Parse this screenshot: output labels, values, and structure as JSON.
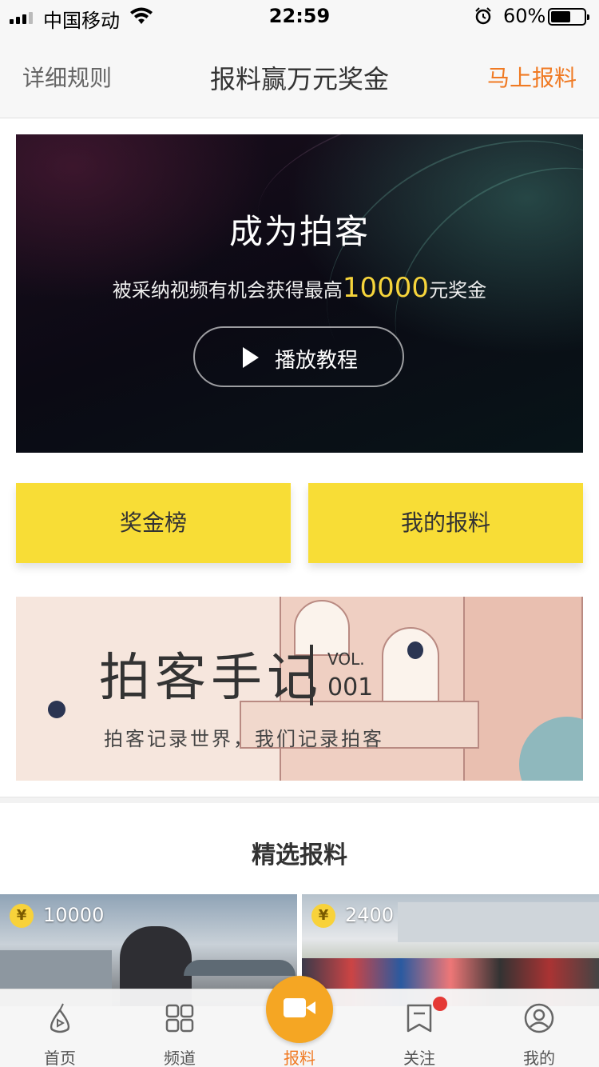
{
  "status_bar": {
    "carrier": "中国移动",
    "time": "22:59",
    "battery": "60%",
    "battery_level": 0.6
  },
  "nav": {
    "left": "详细规则",
    "title": "报料赢万元奖金",
    "right": "马上报料",
    "right_color": "#f07a23"
  },
  "hero": {
    "title": "成为拍客",
    "subtitle_prefix": "被采纳视频有机会获得最高",
    "subtitle_amount": "10000",
    "subtitle_suffix": "元奖金",
    "play_label": "播放教程"
  },
  "buttons": {
    "rank": "奖金榜",
    "mine": "我的报料",
    "color": "#f8dd36"
  },
  "promo": {
    "title": "拍客手记",
    "vol": "VOL.",
    "num": "001",
    "slogan": "拍客记录世界，我们记录拍客"
  },
  "section": {
    "title": "精选报料"
  },
  "cards": [
    {
      "coin": "¥",
      "amount": "10000"
    },
    {
      "coin": "¥",
      "amount": "2400"
    }
  ],
  "tabs": [
    {
      "label": "首页",
      "icon": "home-play-icon"
    },
    {
      "label": "频道",
      "icon": "grid-icon"
    },
    {
      "label": "报料",
      "icon": "camera-icon"
    },
    {
      "label": "关注",
      "icon": "bookmark-icon"
    },
    {
      "label": "我的",
      "icon": "user-icon"
    }
  ],
  "accent_color": "#f5a623"
}
